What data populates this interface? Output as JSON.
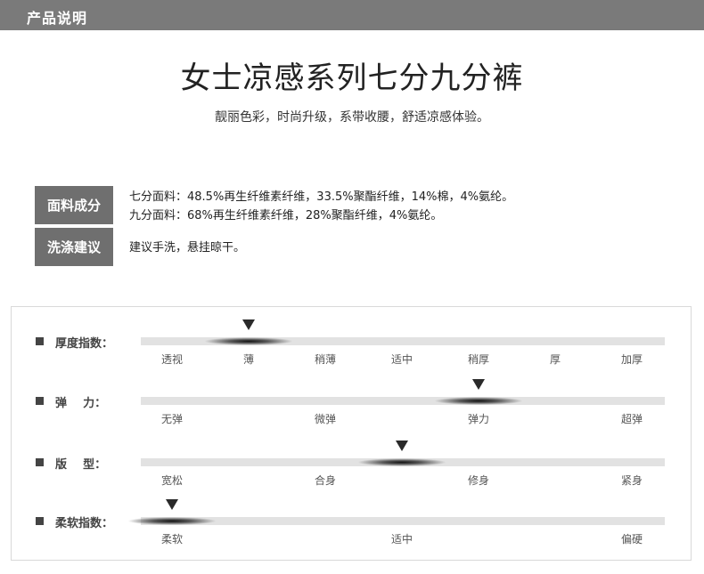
{
  "header": {
    "title": "产品说明"
  },
  "product": {
    "title": "女士凉感系列七分九分裤",
    "subtitle": "靓丽色彩，时尚升级，系带收腰，舒适凉感体验。"
  },
  "material": {
    "label": "面料成分",
    "line1": "七分面料：48.5%再生纤维素纤维，33.5%聚酯纤维，14%棉，4%氨纶。",
    "line2": "九分面料：68%再生纤维素纤维，28%聚酯纤维，4%氨纶。"
  },
  "washing": {
    "label": "洗涤建议",
    "text": "建议手洗，悬挂晾干。"
  },
  "attributes": [
    {
      "label": "厚度指数：",
      "options": [
        "透视",
        "薄",
        "稍薄",
        "适中",
        "稍厚",
        "厚",
        "加厚"
      ],
      "selected_index": 1
    },
    {
      "label": "弹    力：",
      "options": [
        "无弹",
        "微弹",
        "弹力",
        "超弹"
      ],
      "selected_index": 2
    },
    {
      "label": "版    型：",
      "options": [
        "宽松",
        "合身",
        "修身",
        "紧身"
      ],
      "selected_index": 1.5
    },
    {
      "label": "柔软指数：",
      "options": [
        "柔软",
        "适中",
        "偏硬"
      ],
      "selected_index": 0
    }
  ]
}
